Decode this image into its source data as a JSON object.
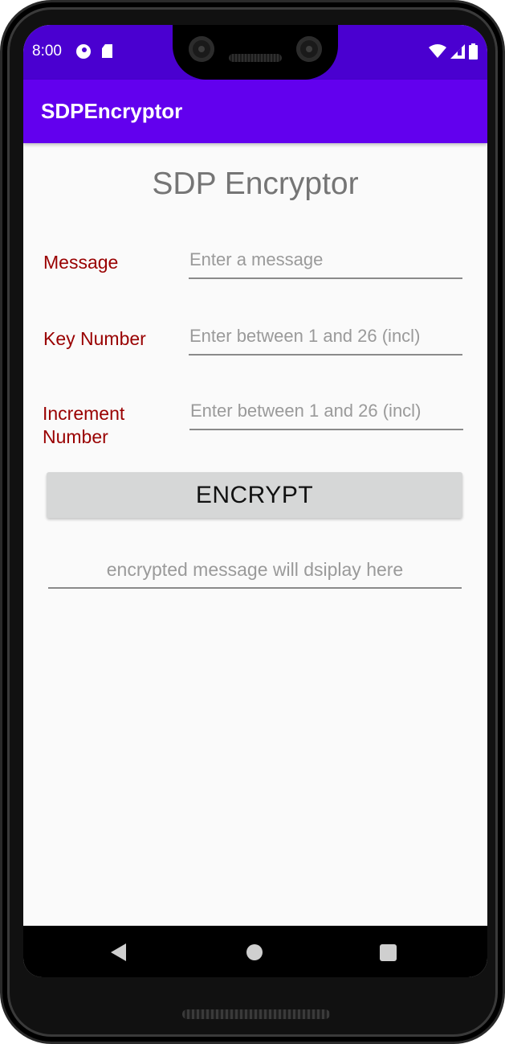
{
  "status_bar": {
    "time": "8:00",
    "icons": [
      "data-saver-icon",
      "sd-card-icon",
      "wifi-icon",
      "cell-signal-icon",
      "battery-icon"
    ]
  },
  "app_bar": {
    "title": "SDPEncryptor"
  },
  "main": {
    "heading": "SDP Encryptor",
    "fields": [
      {
        "label": "Message",
        "value": "",
        "placeholder": "Enter a message"
      },
      {
        "label": "Key Number",
        "value": "",
        "placeholder": "Enter between 1 and 26 (incl)"
      },
      {
        "label": "Increment\nNumber",
        "value": "",
        "placeholder": "Enter between 1 and 26 (incl)"
      }
    ],
    "encrypt_button": "ENCRYPT",
    "output_placeholder": "encrypted message will dsiplay here"
  },
  "nav_bar": {
    "icons": [
      "back-icon",
      "home-icon",
      "recents-icon"
    ]
  },
  "colors": {
    "status_bar": "#4a00d0",
    "app_bar": "#6200ee",
    "label": "#990000",
    "heading": "#757575",
    "button": "#d6d7d7"
  }
}
